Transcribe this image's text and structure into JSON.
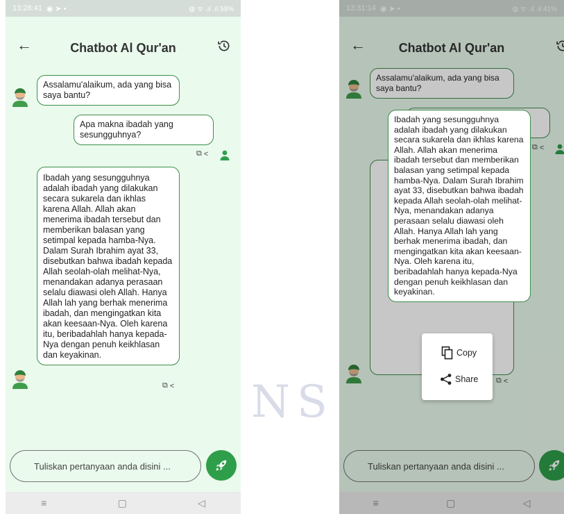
{
  "app": {
    "title": "Chatbot Al Qur'an"
  },
  "icons": {
    "back": "arrow-left-icon",
    "history": "history-icon",
    "send": "rocket-icon",
    "copy": "copy-icon",
    "share": "share-icon",
    "bot": "bot-avatar-icon",
    "user": "user-icon"
  },
  "colors": {
    "background": "#eafaed",
    "accent": "#2f9e4a",
    "bubble_border": "#3a8e48"
  },
  "watermark": {
    "letters_left": "N",
    "letters_right": "S"
  },
  "left_phone": {
    "status_time": "13:28:41",
    "status_battery": "59%",
    "messages": [
      {
        "role": "bot",
        "text": "Assalamu'alaikum, ada yang bisa saya bantu?"
      },
      {
        "role": "user",
        "text": "Apa makna ibadah yang sesungguhnya?"
      },
      {
        "role": "bot",
        "text": "Ibadah yang sesungguhnya adalah ibadah yang dilakukan secara sukarela dan ikhlas karena Allah. Allah akan menerima ibadah tersebut dan memberikan balasan yang setimpal kepada hamba-Nya. Dalam Surah Ibrahim ayat 33, disebutkan bahwa ibadah kepada Allah seolah-olah melihat-Nya, menandakan adanya perasaan selalu diawasi oleh Allah. Hanya Allah lah yang berhak menerima ibadah, dan mengingatkan kita akan keesaan-Nya. Oleh karena itu, beribadahlah hanya kepada-Nya dengan penuh keikhlasan dan keyakinan."
      }
    ],
    "input_placeholder": "Tuliskan pertanyaan anda disini ..."
  },
  "right_phone": {
    "status_time": "13:31:14",
    "status_battery": "41%",
    "messages": [
      {
        "role": "bot",
        "text": "Assalamu'alaikum, ada yang bisa saya bantu?"
      }
    ],
    "popup_text": "Ibadah yang sesungguhnya adalah ibadah yang dilakukan secara sukarela dan ikhlas karena Allah. Allah akan menerima ibadah tersebut dan memberikan balasan yang setimpal kepada hamba-Nya. Dalam Surah Ibrahim ayat 33, disebutkan bahwa ibadah kepada Allah seolah-olah melihat-Nya, menandakan adanya perasaan selalu diawasi oleh Allah. Hanya Allah lah yang berhak menerima ibadah, dan mengingatkan kita akan keesaan-Nya. Oleh karena itu, beribadahlah hanya kepada-Nya dengan penuh keikhlasan dan keyakinan.",
    "context_menu": {
      "copy_label": "Copy",
      "share_label": "Share"
    },
    "input_placeholder": "Tuliskan pertanyaan anda disini ..."
  },
  "nav": {
    "menu": "≡",
    "home": "▢",
    "back": "◁"
  }
}
